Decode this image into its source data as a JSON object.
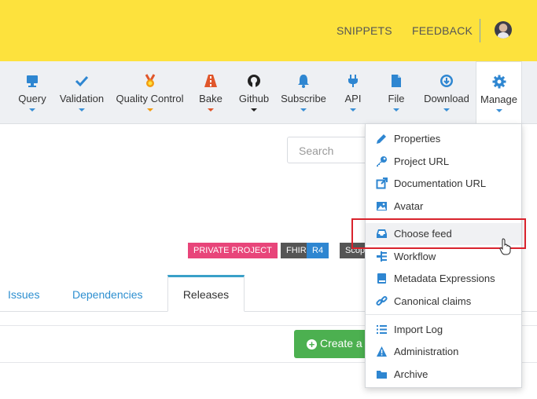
{
  "topbar": {
    "snippets_label": "SNIPPETS",
    "feedback_label": "FEEDBACK",
    "background": "#fde23d"
  },
  "toolbar": {
    "items": [
      {
        "label": "Query",
        "icon": "monitor-icon",
        "color": "#2e86d1"
      },
      {
        "label": "Validation",
        "icon": "check-icon",
        "color": "#2e86d1"
      },
      {
        "label": "Quality Control",
        "icon": "medal-icon",
        "color": "#f39c12"
      },
      {
        "label": "Bake",
        "icon": "road-icon",
        "color": "#e0562b"
      },
      {
        "label": "Github",
        "icon": "github-icon",
        "color": "#222222"
      },
      {
        "label": "Subscribe",
        "icon": "bell-icon",
        "color": "#2e86d1"
      },
      {
        "label": "API",
        "icon": "plug-icon",
        "color": "#2e86d1"
      },
      {
        "label": "File",
        "icon": "file-icon",
        "color": "#2e86d1"
      },
      {
        "label": "Download",
        "icon": "download-icon",
        "color": "#2e86d1"
      },
      {
        "label": "Manage",
        "icon": "gear-icon",
        "color": "#2e86d1"
      }
    ]
  },
  "search": {
    "placeholder": "Search"
  },
  "badges": {
    "private": "PRIVATE PROJECT",
    "fhir": "FHIR",
    "fhir_version": "R4",
    "scope": "Scope"
  },
  "tabs": {
    "issues": "Issues",
    "dependencies": "Dependencies",
    "releases": "Releases"
  },
  "create_button": {
    "label": "Create a"
  },
  "manage_menu": {
    "items": [
      {
        "label": "Properties",
        "icon": "pencil-icon"
      },
      {
        "label": "Project URL",
        "icon": "key-icon"
      },
      {
        "label": "Documentation URL",
        "icon": "external-link-icon"
      },
      {
        "label": "Avatar",
        "icon": "image-icon"
      },
      {
        "label": "Choose feed",
        "icon": "inbox-icon"
      },
      {
        "label": "Workflow",
        "icon": "workflow-icon"
      },
      {
        "label": "Metadata Expressions",
        "icon": "book-icon"
      },
      {
        "label": "Canonical claims",
        "icon": "link-icon"
      },
      {
        "label": "Import Log",
        "icon": "list-icon"
      },
      {
        "label": "Administration",
        "icon": "warning-icon"
      },
      {
        "label": "Archive",
        "icon": "folder-icon"
      }
    ]
  },
  "colors": {
    "accent": "#2e86d1",
    "highlight_border": "#d9232d",
    "create_green": "#4cb050",
    "private_badge": "#e8457a",
    "fhir_badge": "#555555",
    "r4_badge": "#2e86d1"
  }
}
